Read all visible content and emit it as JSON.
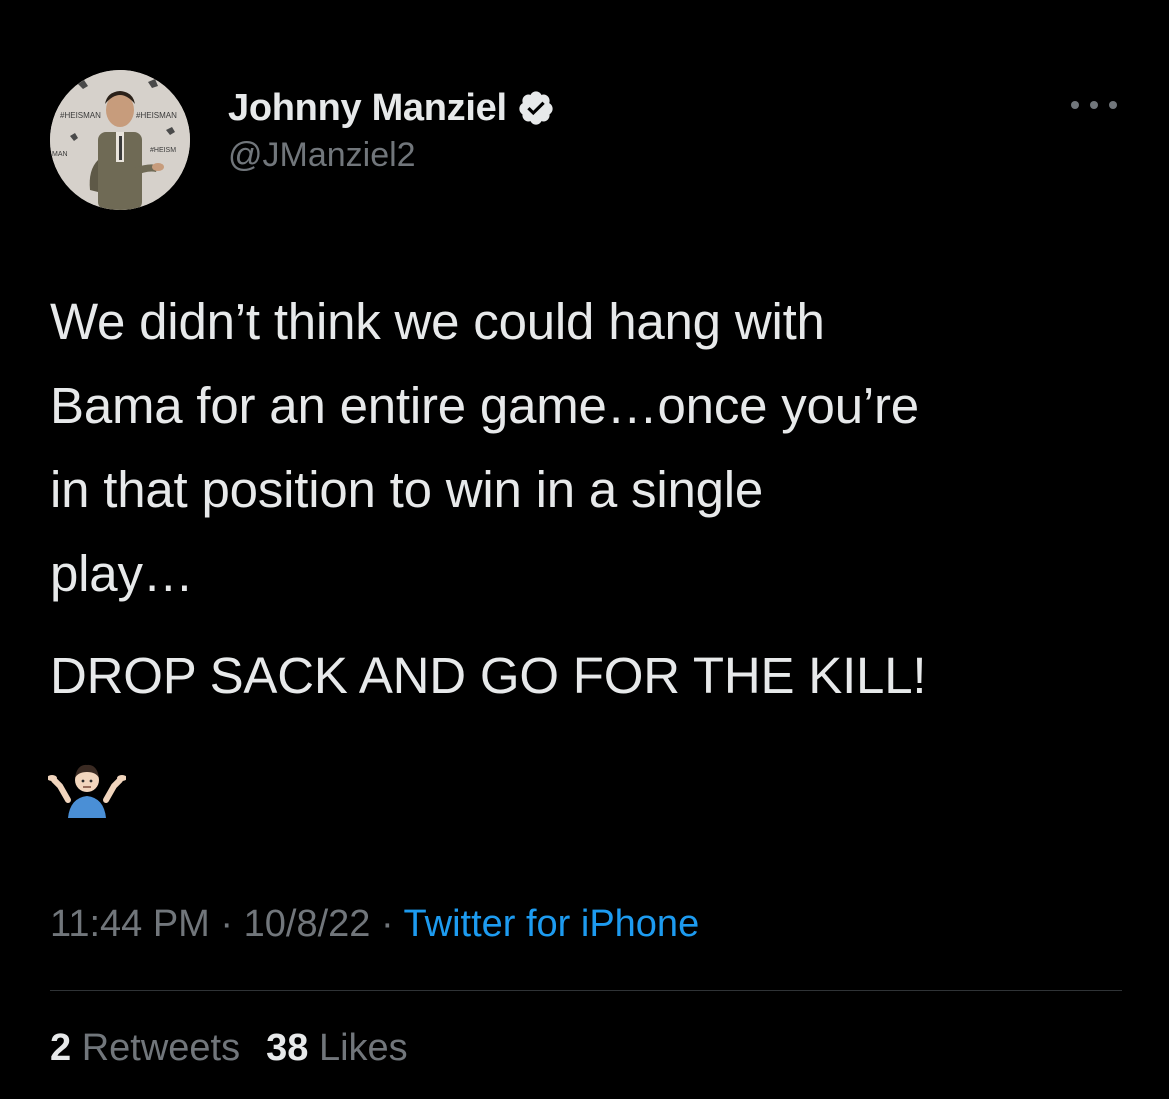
{
  "tweet": {
    "author": {
      "display_name": "Johnny Manziel",
      "handle": "@JManziel2",
      "verified": true,
      "avatar_backdrop_text": [
        "#HEISMAN",
        "#HEISM",
        "HEISMAN",
        "MAN"
      ]
    },
    "text_paragraph_1": "We didn’t think we could hang with\nBama for an entire game…once you’re\nin that position to win in a single\nplay…",
    "text_paragraph_2": "DROP SACK AND GO FOR THE KILL!",
    "emoji": "person-shrugging",
    "time": "11:44 PM",
    "separator": "·",
    "date": "10/8/22",
    "source": "Twitter for iPhone",
    "stats": {
      "retweets_count": "2",
      "retweets_label": "Retweets",
      "likes_count": "38",
      "likes_label": "Likes"
    }
  },
  "colors": {
    "background": "#000000",
    "primary_text": "#e7e9ea",
    "secondary_text": "#71767b",
    "link": "#1d9bf0",
    "divider": "#2f3336"
  }
}
